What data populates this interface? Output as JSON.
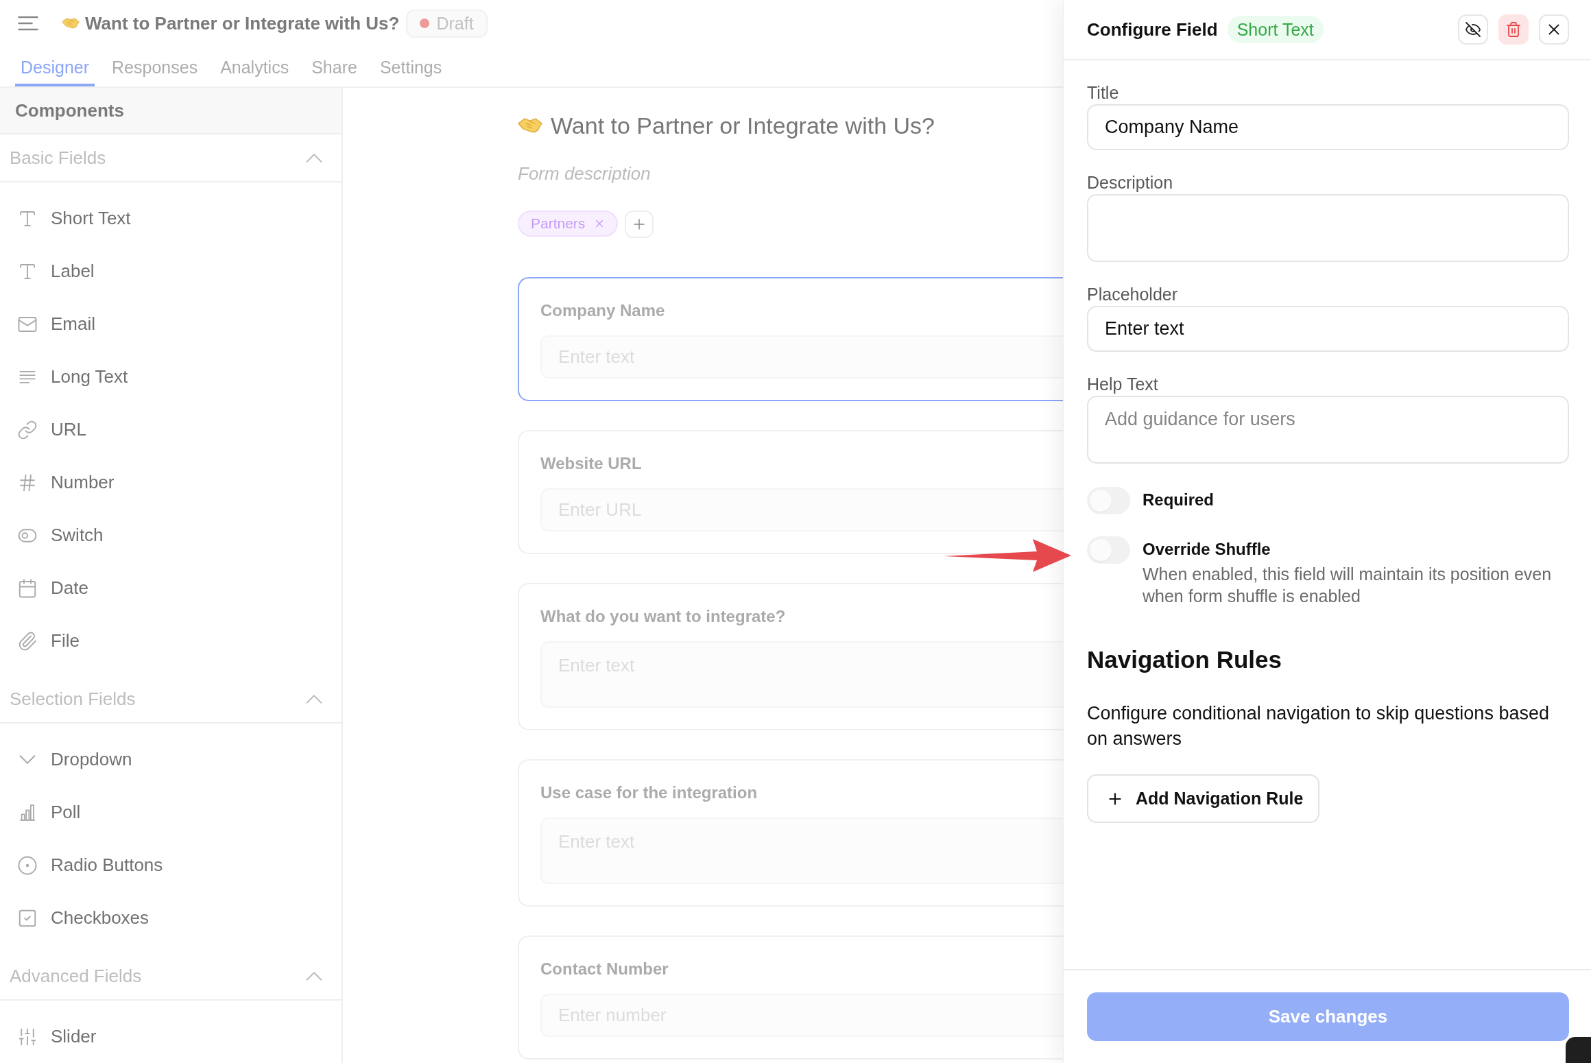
{
  "header": {
    "title": "Want to Partner or Integrate with Us?",
    "status": {
      "label": "Draft"
    }
  },
  "tabs": [
    {
      "label": "Designer",
      "selected": true
    },
    {
      "label": "Responses",
      "selected": false
    },
    {
      "label": "Analytics",
      "selected": false
    },
    {
      "label": "Share",
      "selected": false
    },
    {
      "label": "Settings",
      "selected": false
    }
  ],
  "sidebar": {
    "title": "Components",
    "sections": [
      {
        "title": "Basic Fields",
        "expanded": true,
        "items": [
          {
            "label": "Short Text",
            "kind": "text"
          },
          {
            "label": "Label",
            "kind": "label"
          },
          {
            "label": "Email",
            "kind": "email"
          },
          {
            "label": "Long Text",
            "kind": "long_text"
          },
          {
            "label": "URL",
            "kind": "url"
          },
          {
            "label": "Number",
            "kind": "number"
          },
          {
            "label": "Switch",
            "kind": "switch"
          },
          {
            "label": "Date",
            "kind": "date"
          },
          {
            "label": "File",
            "kind": "file"
          }
        ]
      },
      {
        "title": "Selection Fields",
        "expanded": true,
        "items": [
          {
            "label": "Dropdown",
            "kind": "dropdown"
          },
          {
            "label": "Poll",
            "kind": "poll"
          },
          {
            "label": "Radio Buttons",
            "kind": "radio"
          },
          {
            "label": "Checkboxes",
            "kind": "checkbox"
          }
        ]
      },
      {
        "title": "Advanced Fields",
        "expanded": true,
        "items": [
          {
            "label": "Slider",
            "kind": "slider"
          }
        ]
      }
    ]
  },
  "form": {
    "title": "Want to Partner or Integrate with Us?",
    "description": {
      "placeholder": "Form description"
    },
    "tags": [
      {
        "label": "Partners"
      }
    ],
    "fields": [
      {
        "label": "Company Name",
        "placeholder": "Enter text",
        "kind": "input",
        "selected": true
      },
      {
        "label": "Website URL",
        "placeholder": "Enter URL",
        "kind": "input",
        "selected": false
      },
      {
        "label": "What do you want to integrate?",
        "placeholder": "Enter text",
        "kind": "textarea",
        "selected": false
      },
      {
        "label": "Use case for the integration",
        "placeholder": "Enter text",
        "kind": "textarea",
        "selected": false
      },
      {
        "label": "Contact Number",
        "placeholder": "Enter number",
        "kind": "input",
        "selected": false
      }
    ]
  },
  "panel": {
    "title": "Configure Field",
    "badge": "Short Text",
    "fields": [
      {
        "label": "Title",
        "value": "Company Name",
        "kind": "input"
      },
      {
        "label": "Description",
        "kind": "textarea"
      },
      {
        "label": "Placeholder",
        "value": "Enter text",
        "kind": "input"
      },
      {
        "label": "Help Text",
        "placeholder": "Add guidance for users",
        "kind": "textarea"
      }
    ],
    "toggles": [
      {
        "label": "Required",
        "on": false
      },
      {
        "label": "Override Shuffle",
        "on": false,
        "description": "When enabled, this field will maintain its position even when form shuffle is enabled"
      }
    ],
    "navigation": {
      "title": "Navigation Rules",
      "text": "Configure conditional navigation to skip questions based on answers",
      "button": "Add Navigation Rule"
    },
    "save_button": {
      "label": "Save changes",
      "disabled": true
    }
  }
}
